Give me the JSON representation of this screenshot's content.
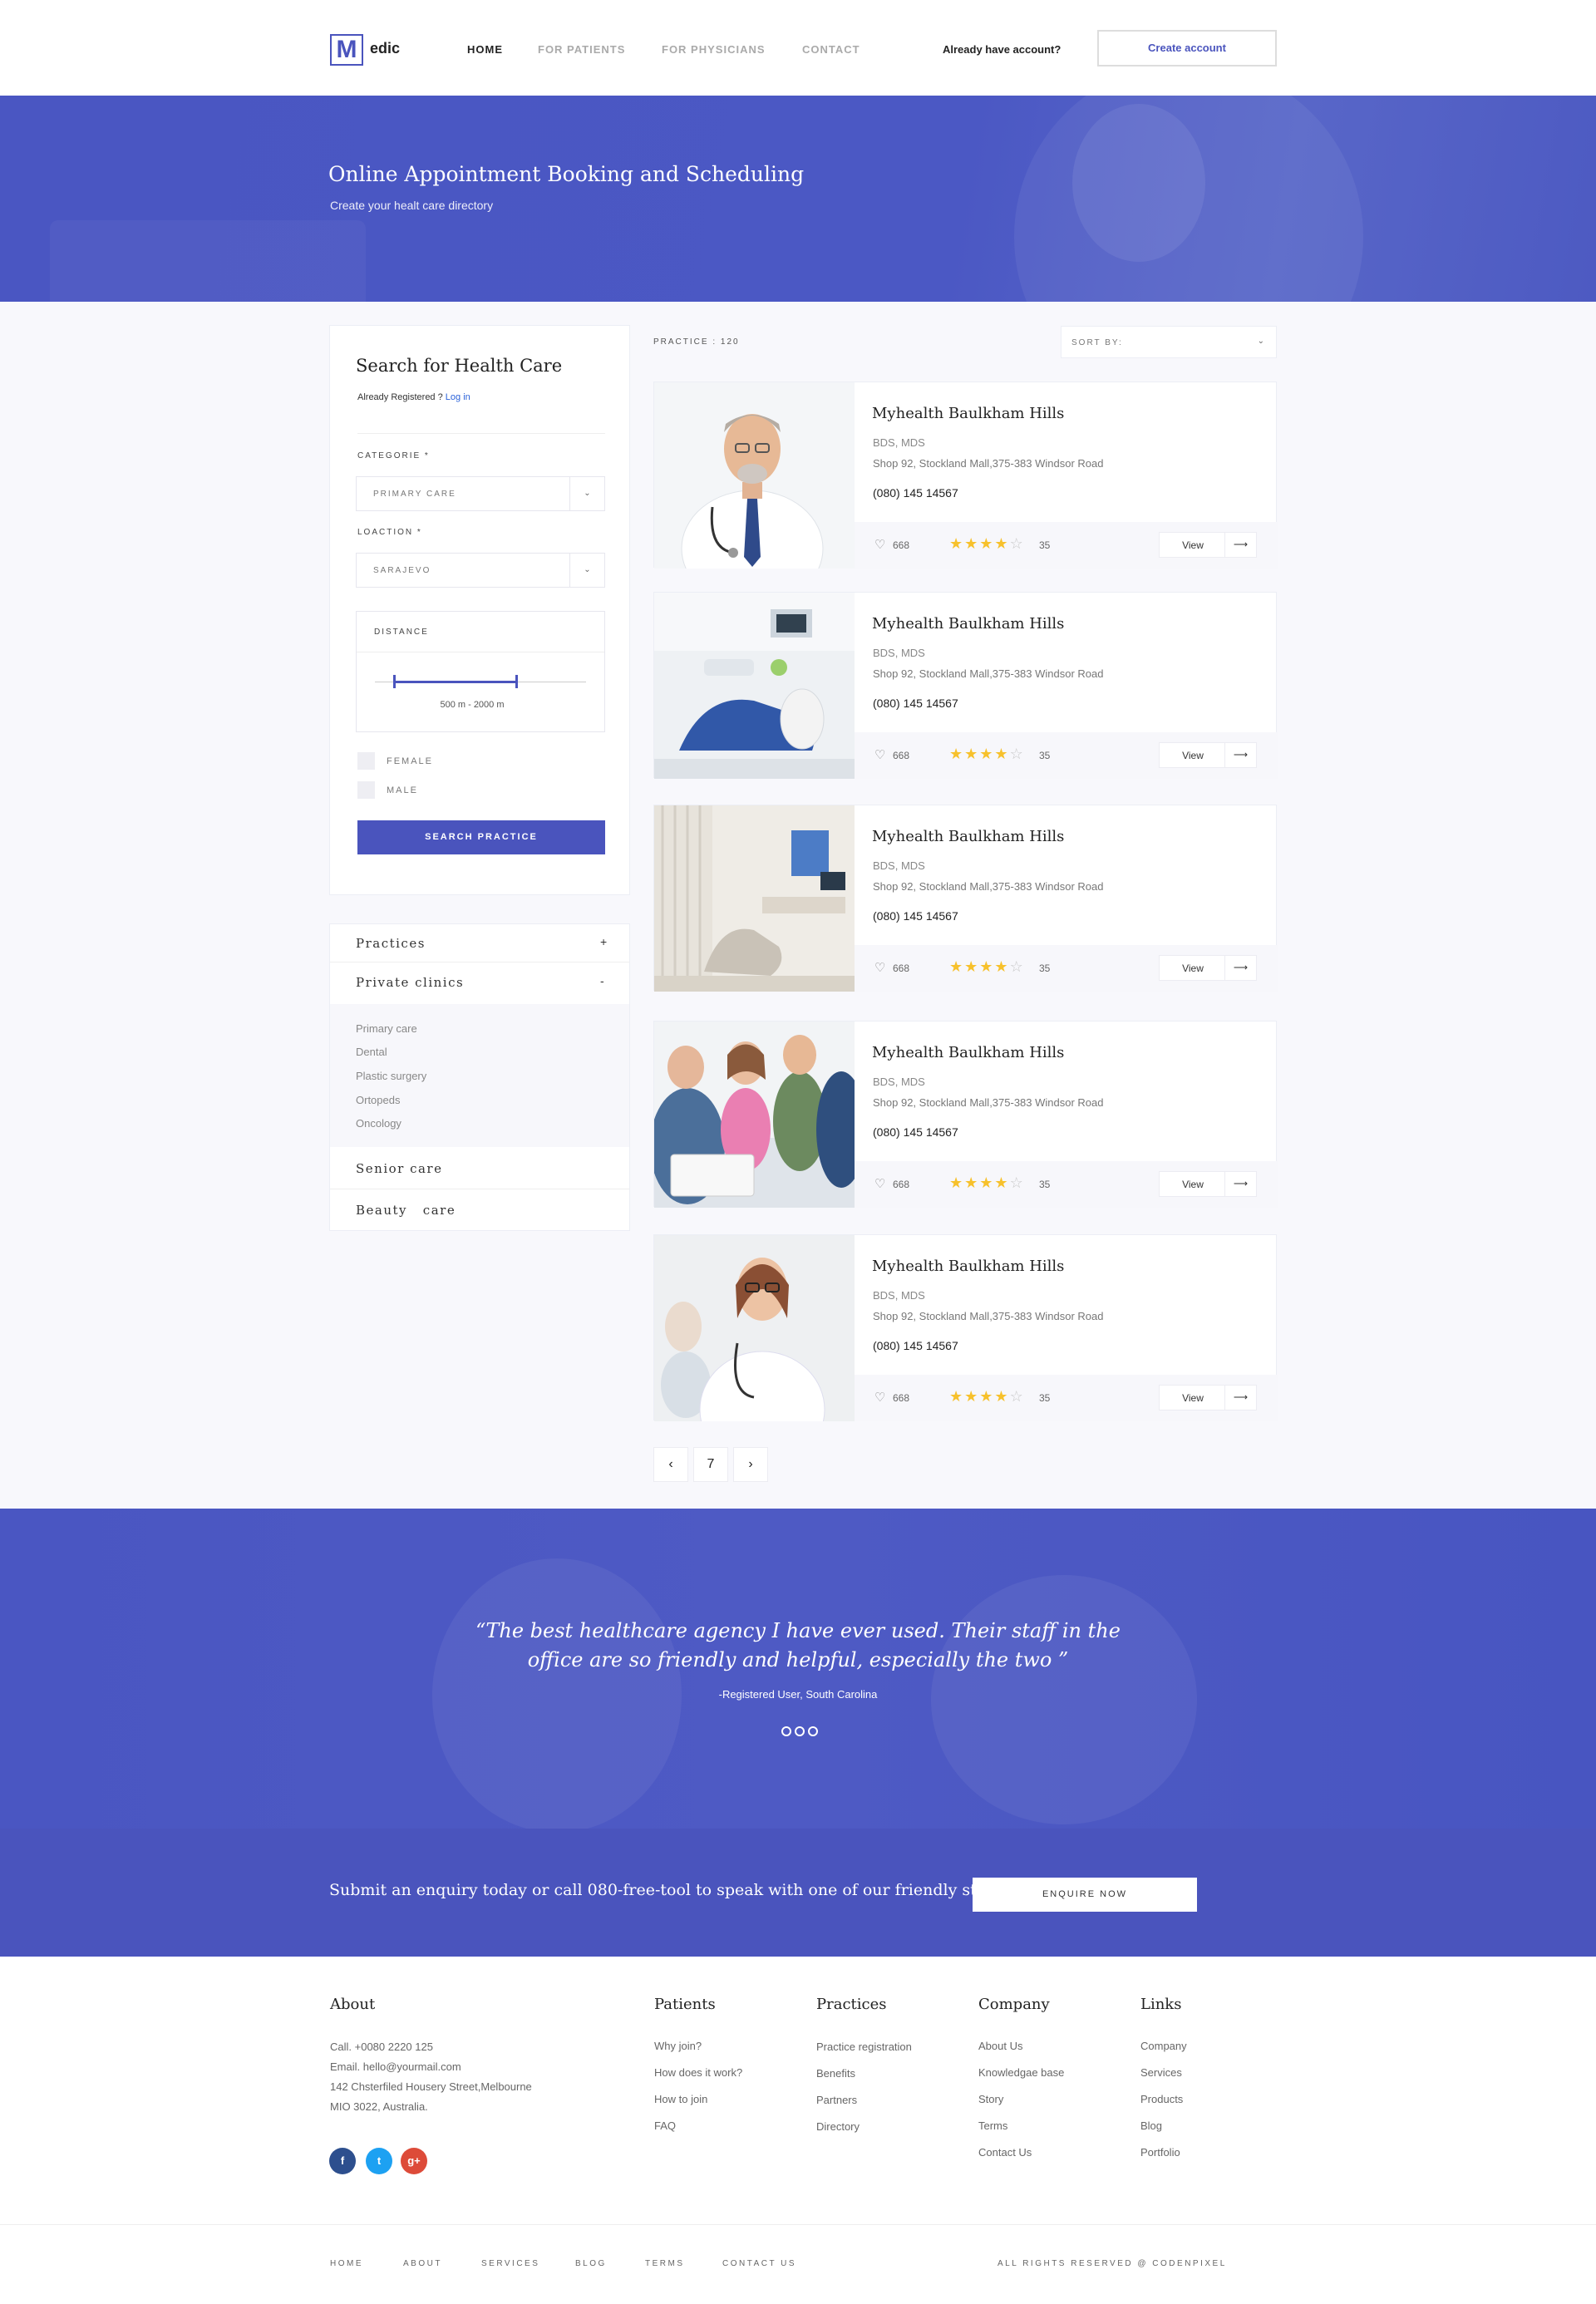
{
  "header": {
    "logo_letter": "M",
    "logo_text": "edic",
    "nav": [
      "HOME",
      "FOR PATIENTS",
      "FOR PHYSICIANS",
      "CONTACT"
    ],
    "have_account": "Already have account?",
    "create_account": "Create account"
  },
  "hero": {
    "title": "Online Appointment Booking and Scheduling",
    "subtitle": "Create your healt care directory"
  },
  "search": {
    "title": "Search for Health Care",
    "registered_prefix": "Already Registered ?",
    "login_link": "Log in",
    "category_label": "CATEGORIE *",
    "category_value": "PRIMARY CARE",
    "location_label": "LOACTION *",
    "location_value": "SARAJEVO",
    "distance_label": "DISTANCE",
    "distance_range": "500 m - 2000 m",
    "distance_min_fraction": 0.09,
    "distance_max_fraction": 0.67,
    "female_label": "FEMALE",
    "male_label": "MALE",
    "button": "SEARCH PRACTICE"
  },
  "categories": [
    {
      "label": "Practices",
      "sign": "+"
    },
    {
      "label": "Private clinics",
      "sign": "-"
    },
    {
      "label": "Senior care"
    },
    {
      "label": "Beauty   care"
    }
  ],
  "subcategories": [
    "Primary care",
    "Dental",
    "Plastic surgery",
    "Ortopeds",
    "Oncology"
  ],
  "listing": {
    "count_label": "PRACTICE : 120",
    "sort_label": "SORT BY:",
    "items": [
      {
        "name": "Myhealth Baulkham Hills",
        "degree": "BDS, MDS",
        "address": "Shop 92, Stockland Mall,375-383 Windsor Road",
        "phone": "(080) 145 14567",
        "likes": "668",
        "rating": 4,
        "reviews": "35",
        "view": "View"
      },
      {
        "name": "Myhealth Baulkham Hills",
        "degree": "BDS, MDS",
        "address": "Shop 92, Stockland Mall,375-383 Windsor Road",
        "phone": "(080) 145 14567",
        "likes": "668",
        "rating": 4,
        "reviews": "35",
        "view": "View"
      },
      {
        "name": "Myhealth Baulkham Hills",
        "degree": "BDS, MDS",
        "address": "Shop 92, Stockland Mall,375-383 Windsor Road",
        "phone": "(080) 145 14567",
        "likes": "668",
        "rating": 4,
        "reviews": "35",
        "view": "View"
      },
      {
        "name": "Myhealth Baulkham Hills",
        "degree": "BDS, MDS",
        "address": "Shop 92, Stockland Mall,375-383 Windsor Road",
        "phone": "(080) 145 14567",
        "likes": "668",
        "rating": 4,
        "reviews": "35",
        "view": "View"
      },
      {
        "name": "Myhealth Baulkham Hills",
        "degree": "BDS, MDS",
        "address": "Shop 92, Stockland Mall,375-383 Windsor Road",
        "phone": "(080) 145 14567",
        "likes": "668",
        "rating": 4,
        "reviews": "35",
        "view": "View"
      }
    ],
    "pagination": {
      "prev": "‹",
      "page": "7",
      "next": "›"
    }
  },
  "testimonial": {
    "quote_line1": "“The best healthcare agency I have ever used. Their staff in the",
    "quote_line2": "office are so friendly and helpful, especially the two ”",
    "author": "-Registered User, South Carolina"
  },
  "enquiry": {
    "text": "Submit an enquiry today or call 080-free-tool  to speak with one of our friendly staff.",
    "button": "ENQUIRE NOW"
  },
  "footer": {
    "about": {
      "title": "About",
      "lines": [
        "Call. +0080 2220 125",
        "Email. hello@yourmail.com",
        "142 Chsterfiled Housery Street,Melbourne",
        "MIO 3022, Australia."
      ]
    },
    "columns": [
      {
        "title": "Patients",
        "links": [
          "Why join?",
          "How does it work?",
          "How to join",
          "FAQ"
        ]
      },
      {
        "title": "Practices",
        "links": [
          "Practice registration",
          "Benefits",
          "Partners",
          "Directory"
        ]
      },
      {
        "title": "Company",
        "links": [
          "About Us",
          "Knowledgae base",
          "Story",
          "Terms",
          "Contact Us"
        ]
      },
      {
        "title": "Links",
        "links": [
          "Company",
          "Services",
          "Products",
          "Blog",
          "Portfolio"
        ]
      }
    ],
    "social": [
      {
        "icon": "facebook-icon",
        "glyph": "f",
        "color": "#2d4f8e"
      },
      {
        "icon": "twitter-icon",
        "glyph": "t",
        "color": "#1da1f2"
      },
      {
        "icon": "google-plus-icon",
        "glyph": "g+",
        "color": "#dd4b39"
      }
    ],
    "bottom_links": [
      "HOME",
      "ABOUT",
      "SERVICES",
      "BLOG",
      "TERMS",
      "CONTACT US"
    ],
    "copyright": "ALL RIGHTS RESERVED @ CODENPIXEL"
  },
  "colors": {
    "accent": "#4a54bd",
    "star": "#f7c12c"
  }
}
